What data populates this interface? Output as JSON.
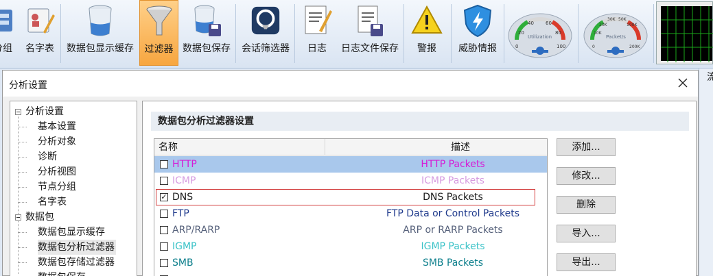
{
  "toolbar": {
    "items": [
      {
        "label": "分组",
        "icon": "group-icon"
      },
      {
        "label": "名字表",
        "icon": "name-table-icon"
      },
      {
        "label": "数据包显示缓存",
        "icon": "packet-buffer-icon"
      },
      {
        "label": "过滤器",
        "icon": "funnel-icon",
        "active": true
      },
      {
        "label": "数据包保存",
        "icon": "save-packets-icon"
      },
      {
        "label": "会话筛选器",
        "icon": "session-filter-icon"
      },
      {
        "label": "日志",
        "icon": "log-icon"
      },
      {
        "label": "日志文件保存",
        "icon": "log-save-icon"
      },
      {
        "label": "警报",
        "icon": "warning-icon"
      },
      {
        "label": "威胁情报",
        "icon": "threat-shield-icon"
      }
    ],
    "gauges": [
      {
        "title": "Utilization",
        "ticks": [
          "0",
          "20",
          "40",
          "60",
          "80",
          "100"
        ],
        "level": 0
      },
      {
        "title": "Packet/s",
        "ticks": [
          "0",
          "10K",
          "20K",
          "30K",
          "50K",
          "100K",
          "200K"
        ],
        "level": 0
      }
    ],
    "right_partial_label": "流"
  },
  "dialog": {
    "title": "分析设置",
    "close_glyph": "✕"
  },
  "tree": {
    "groups": [
      {
        "label": "分析设置",
        "children": [
          "基本设置",
          "分析对象",
          "诊断",
          "分析视图",
          "节点分组",
          "名字表"
        ]
      },
      {
        "label": "数据包",
        "children": [
          "数据包显示缓存",
          "数据包分析过滤器",
          "数据包存储过滤器",
          "数据包保存"
        ]
      }
    ]
  },
  "panel": {
    "heading": "数据包分析过滤器设置",
    "columns": {
      "name": "名称",
      "desc": "描述"
    },
    "rows": [
      {
        "name": "HTTP",
        "desc": "HTTP Packets",
        "checked": false,
        "color": "#d61ad6",
        "selected": true
      },
      {
        "name": "ICMP",
        "desc": "ICMP Packets",
        "checked": false,
        "color": "#d79be0"
      },
      {
        "name": "DNS",
        "desc": "DNS Packets",
        "checked": true,
        "color": "#1a1a1a",
        "boxed": true
      },
      {
        "name": "FTP",
        "desc": "FTP Data or Control Packets",
        "checked": false,
        "color": "#1f3a8c"
      },
      {
        "name": "ARP/RARP",
        "desc": "ARP or RARP Packets",
        "checked": false,
        "color": "#55607a"
      },
      {
        "name": "IGMP",
        "desc": "IGMP Packets",
        "checked": false,
        "color": "#3cc3c8"
      },
      {
        "name": "SMB",
        "desc": "SMB Packets",
        "checked": false,
        "color": "#0d7f8c"
      }
    ],
    "buttons": [
      "添加...",
      "修改...",
      "删除",
      "导入...",
      "导出..."
    ]
  }
}
